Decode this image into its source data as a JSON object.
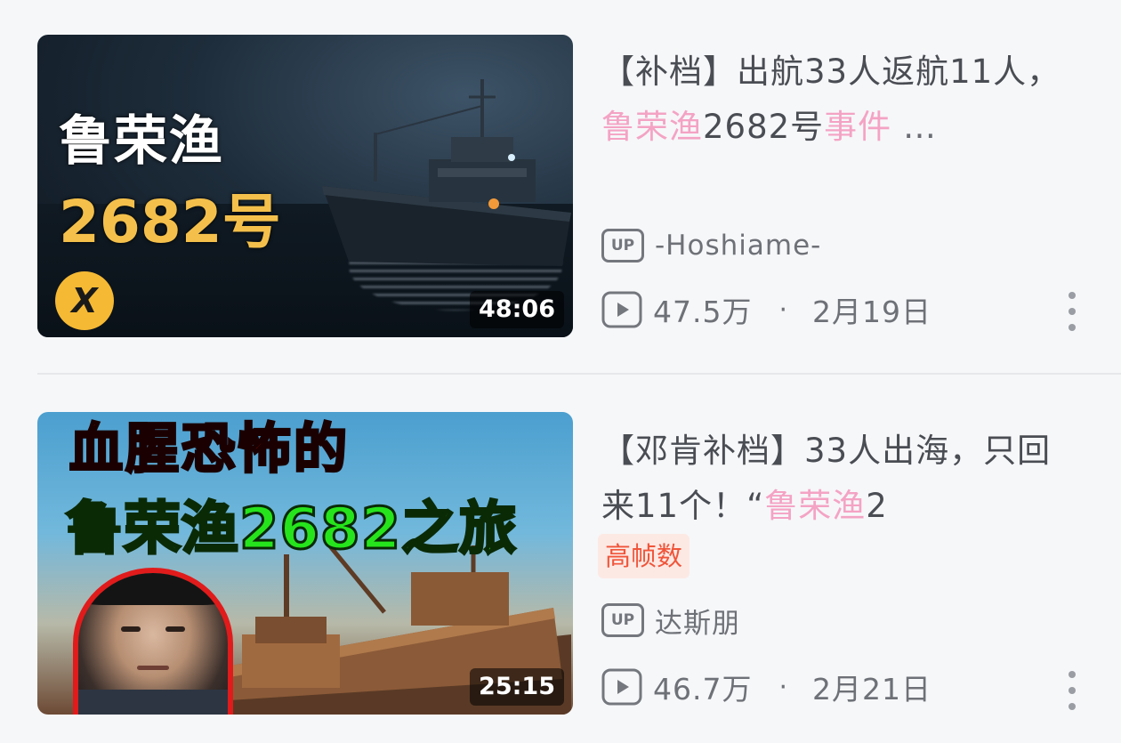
{
  "videos": [
    {
      "thumb_text_1": "鲁荣渔",
      "thumb_text_2": "2682号",
      "logo_text": "X",
      "duration": "48:06",
      "title_parts": [
        "【补档】出航33人返航11人，",
        "鲁荣渔",
        "2682号",
        "事件",
        "…"
      ],
      "up_label": "UP",
      "uploader": "-Hoshiame-",
      "views": "47.5万",
      "separator": "·",
      "date": "2月19日"
    },
    {
      "thumb_text_1": "血腥恐怖的",
      "thumb_text_2": "鲁荣渔2682之旅",
      "duration": "25:15",
      "title_parts": [
        "【邓肯补档】33人出海，只回来11个！“",
        "鲁荣渔",
        "2"
      ],
      "tag": "高帧数",
      "up_label": "UP",
      "uploader": "达斯朋",
      "views": "46.7万",
      "separator": "·",
      "date": "2月21日"
    }
  ]
}
